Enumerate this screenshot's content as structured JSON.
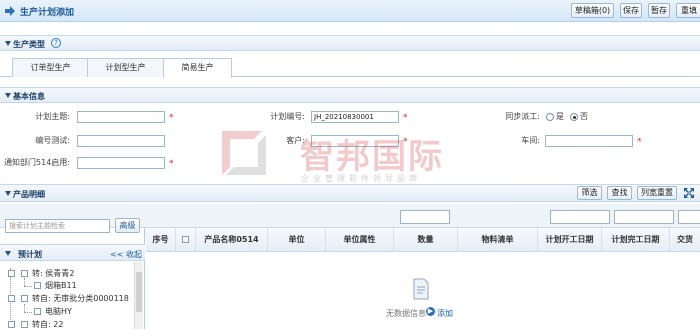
{
  "header": {
    "title": "生产计划添加",
    "buttons": [
      "草稿箱(0)",
      "保存",
      "暂存",
      "重填"
    ]
  },
  "prod_type": {
    "title": "生产类型",
    "tabs": [
      "订单型生产",
      "计划型生产",
      "简易生产"
    ],
    "active_tab": 2
  },
  "basic": {
    "title": "基本信息",
    "fields": {
      "subject_label": "计划主题:",
      "plan_no_label": "计划编号:",
      "plan_no_value": "JH_20210830001",
      "sync_label": "同步派工:",
      "sync_yes": "是",
      "sync_no": "否",
      "sync_value": "否",
      "code_rule_label": "编号测试:",
      "customer_label": "客户:",
      "workshop_label": "车间:",
      "notify_label": "通知部门514启用:"
    }
  },
  "watermark": {
    "big": "智邦国际",
    "small": "企业管理软件领导品牌"
  },
  "products": {
    "title": "产品明细",
    "buttons": [
      "筛选",
      "查找",
      "列宽重置"
    ],
    "search_placeholder": "搜索计划主题检索",
    "advanced": "高级",
    "pre_plan": "预计划",
    "collapse": "<< 收起",
    "tree": [
      {
        "text": "转: 侯青青2",
        "level": 0
      },
      {
        "text": "烟箱B11",
        "level": 1
      },
      {
        "text": "转自: 无审批分类0000118",
        "level": 0
      },
      {
        "text": "电脑HY",
        "level": 1
      },
      {
        "text": "转自: 22",
        "level": 0
      }
    ],
    "columns": [
      "序号",
      "",
      "产品名称0514",
      "单位",
      "单位属性",
      "数量",
      "物料清单",
      "计划开工日期",
      "计划完工日期",
      "交货"
    ],
    "empty_text": "无数据信息",
    "add": "添加"
  },
  "colors": {
    "accent": "#1f5b9a",
    "required": "#e02020"
  }
}
